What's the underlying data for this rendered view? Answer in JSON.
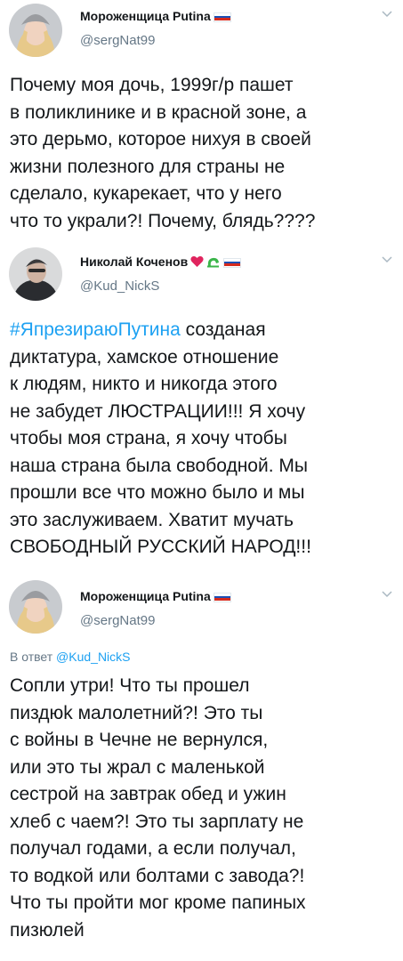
{
  "tweets": [
    {
      "display_name": "Мороженщица Putina",
      "handle": "@sergNat99",
      "text": "Почему моя дочь, 1999г/р пашет\nв поликлинике и в красной зоне, а\nэто дерьмо, которое нихуя в своей\nжизни полезного для страны не\nсделало, кукарекает, что у него\nчто то украли?! Почему, блядь????",
      "icons": [
        "russian-flag-icon"
      ]
    },
    {
      "display_name": "Николай Коченов",
      "handle": "@Kud_NickS",
      "hashtag": "#ЯпрезираюПутина",
      "text": " созданая\nдиктатура, хамское отношение\nк людям, никто и никогда этого\nне забудет ЛЮСТРАЦИИ!!! Я хочу\nчтобы моя страна, я хочу чтобы\nнаша страна была свободной. Мы\nпрошли все что можно было и мы\nэто заслуживаем. Хватит мучать\nСВОБОДНЫЙ РУССКИЙ НАРОД!!!",
      "icons": [
        "red-heart-icon",
        "green-lamp-icon",
        "russian-flag-icon"
      ]
    },
    {
      "display_name": "Мороженщица Putina",
      "handle": "@sergNat99",
      "reply_prefix": "В ответ ",
      "reply_mention": "@Kud_NickS",
      "text": "Сопли утри! Что ты прошел\nпиздюk малолетний?! Это ты\nс войны в Чечне не вернулся,\nили это ты жрал с маленькой\nсестрой на завтрак обед и ужин\nхлеб с чаем?! Это ты зарплату не\nполучал годами, а если получал,\nто водкой или болтами с завода?!\nЧто ты пройти мог кроме папиных\nпизюлей",
      "icons": [
        "russian-flag-icon"
      ]
    }
  ],
  "colors": {
    "text": "#14171a",
    "secondary": "#657786",
    "link": "#1da1f2",
    "heart": "#e0245e",
    "lamp": "#3bb54a"
  }
}
